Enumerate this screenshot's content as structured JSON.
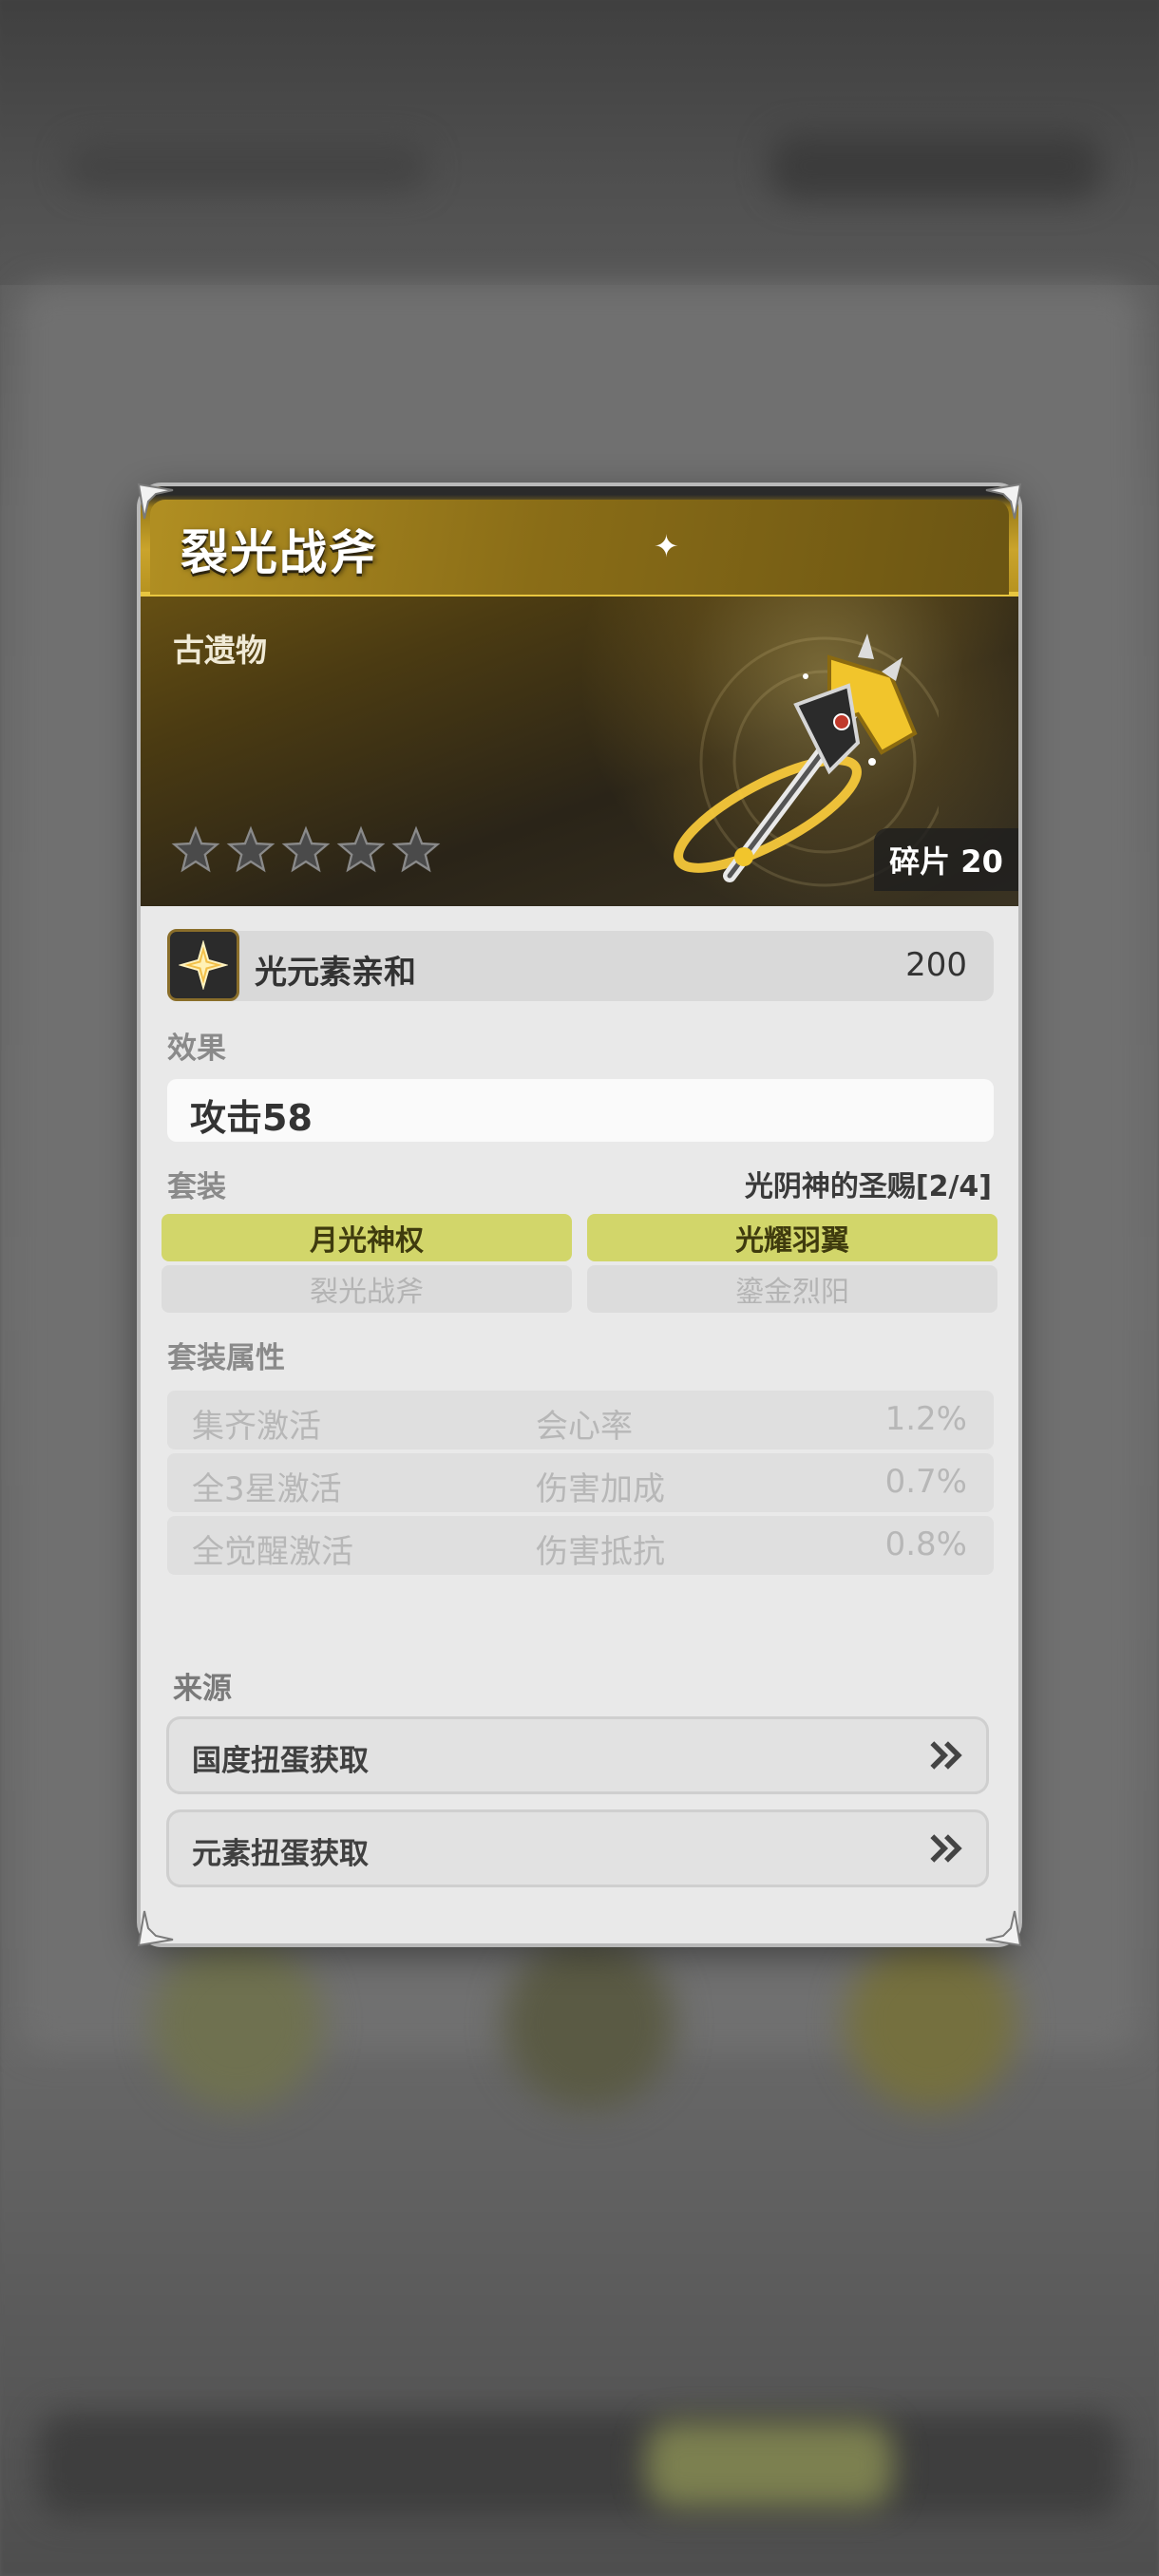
{
  "item": {
    "title": "裂光战斧",
    "category": "古遗物",
    "stars": 5,
    "fragment_label": "碎片 20"
  },
  "affinity": {
    "icon": "light-element-icon",
    "label": "光元素亲和",
    "value": "200"
  },
  "effect": {
    "section_label": "效果",
    "text": "攻击58"
  },
  "set": {
    "section_label": "套装",
    "name": "光阴神的圣赐[2/4]",
    "pieces": [
      {
        "label": "月光神权",
        "active": true
      },
      {
        "label": "光耀羽翼",
        "active": true
      },
      {
        "label": "裂光战斧",
        "active": false
      },
      {
        "label": "鎏金烈阳",
        "active": false
      }
    ]
  },
  "set_attributes": {
    "section_label": "套装属性",
    "rows": [
      {
        "condition": "集齐激活",
        "attribute": "会心率",
        "value": "1.2%"
      },
      {
        "condition": "全3星激活",
        "attribute": "伤害加成",
        "value": "0.7%"
      },
      {
        "condition": "全觉醒激活",
        "attribute": "伤害抵抗",
        "value": "0.8%"
      }
    ]
  },
  "source": {
    "section_label": "来源",
    "buttons": [
      {
        "label": "国度扭蛋获取",
        "icon": "double-chevron-right-icon"
      },
      {
        "label": "元素扭蛋获取",
        "icon": "double-chevron-right-icon"
      }
    ]
  },
  "colors": {
    "accent_gold": "#e8c640",
    "set_active": "#d2d66a"
  }
}
